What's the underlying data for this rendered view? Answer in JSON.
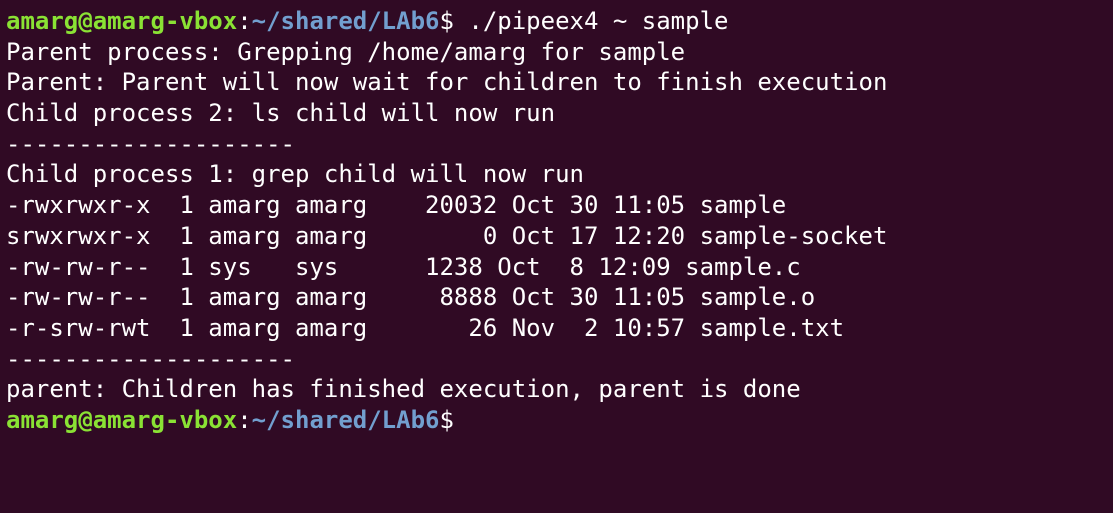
{
  "prompt": {
    "user_host": "amarg@amarg-vbox",
    "colon": ":",
    "path": "~/shared/LAb6",
    "dollar": "$"
  },
  "command": " ./pipeex4 ~ sample",
  "output": [
    "Parent process: Grepping /home/amarg for sample",
    "Parent: Parent will now wait for children to finish execution",
    "Child process 2: ls child will now run",
    "--------------------",
    "Child process 1: grep child will now run",
    "-rwxrwxr-x  1 amarg amarg    20032 Oct 30 11:05 sample",
    "srwxrwxr-x  1 amarg amarg        0 Oct 17 12:20 sample-socket",
    "-rw-rw-r--  1 sys   sys      1238 Oct  8 12:09 sample.c",
    "-rw-rw-r--  1 amarg amarg     8888 Oct 30 11:05 sample.o",
    "-r-srw-rwt  1 amarg amarg       26 Nov  2 10:57 sample.txt",
    "--------------------",
    "parent: Children has finished execution, parent is done"
  ],
  "colors": {
    "background": "#300a24",
    "prompt_user": "#8ae234",
    "prompt_path": "#729fcf",
    "text": "#ffffff"
  }
}
